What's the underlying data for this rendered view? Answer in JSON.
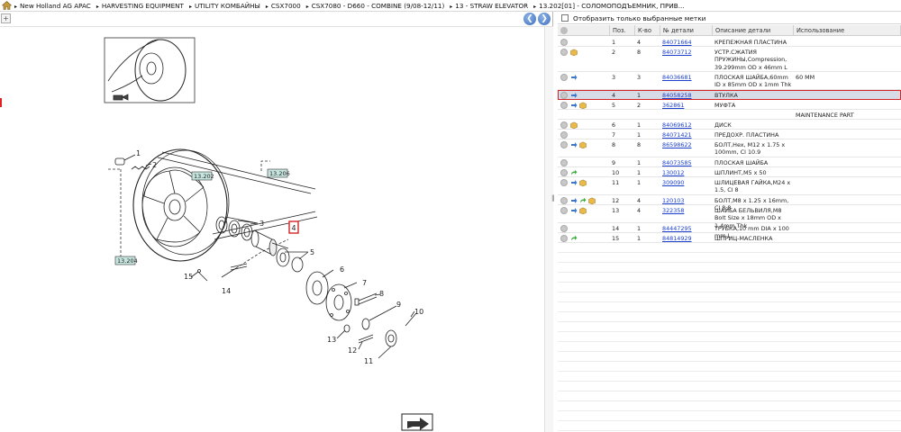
{
  "breadcrumb": [
    "New Holland AG APAC",
    "HARVESTING EQUIPMENT",
    "UTILITY КОМБАЙНЫ",
    "CSX7000",
    "CSX7080 - D660 - COMBINE (9/08-12/11)",
    "13 - STRAW ELEVATOR",
    "13.202[01] - СОЛОМОПОДЪЕМНИК, ПРИВ..."
  ],
  "icons": {
    "home": "home-icon",
    "back": "back-arrow-icon",
    "forward": "forward-arrow-icon",
    "expand": "expand-icon",
    "settings": "settings-icon"
  },
  "nav": {
    "back": "❮",
    "forward": "❯",
    "expand": "+",
    "splitter": "‖"
  },
  "filter": {
    "label": "Отобразить только выбранные метки",
    "checked": false
  },
  "columns": [
    "Поз.",
    "К-во",
    "№ детали",
    "Описание детали",
    "Использование"
  ],
  "colors": {
    "selected_row": "#d6dbe6",
    "highlight": "#d42424",
    "link": "#1a3fcc",
    "callout_bg": "#c7e6e0"
  },
  "diagram": {
    "callouts": [
      "1",
      "2",
      "3",
      "4",
      "5",
      "6",
      "7",
      "8",
      "9",
      "10",
      "11",
      "12",
      "13",
      "14",
      "15"
    ],
    "refs": [
      "13.202",
      "13.206",
      "13.204"
    ]
  },
  "rows": [
    {
      "pos": "1",
      "qty": "4",
      "part": "84071664",
      "desc": "КРЕПЕЖНАЯ ПЛАСТИНА",
      "use": "",
      "icons": []
    },
    {
      "pos": "2",
      "qty": "8",
      "part": "84073712",
      "desc": "УСТР.СЖАТИЯ ПРУЖИНЫ,Compression, 39.299mm OD x 46mm L",
      "use": "",
      "icons": [
        "box"
      ]
    },
    {
      "pos": "3",
      "qty": "3",
      "part": "84036681",
      "desc": "ПЛОСКАЯ ШАЙБА,60mm ID x 85mm OD x 1mm Thk",
      "use": "60 MM",
      "icons": [
        "swap"
      ]
    },
    {
      "pos": "4",
      "qty": "1",
      "part": "84058258",
      "desc": "ВТУЛКА",
      "use": "",
      "icons": [
        "swap"
      ],
      "selected": true
    },
    {
      "pos": "5",
      "qty": "2",
      "part": "362861",
      "desc": "МУФТА",
      "use": "",
      "icons": [
        "swap",
        "box"
      ]
    },
    {
      "pos": "",
      "qty": "",
      "part": "",
      "desc": "",
      "use": "MAINTENANCE PART",
      "icons": [],
      "note": true
    },
    {
      "pos": "6",
      "qty": "1",
      "part": "84069612",
      "desc": "ДИСК",
      "use": "",
      "icons": [
        "box"
      ]
    },
    {
      "pos": "7",
      "qty": "1",
      "part": "84071421",
      "desc": "ПРЕДОХР. ПЛАСТИНА",
      "use": "",
      "icons": []
    },
    {
      "pos": "8",
      "qty": "8",
      "part": "86598622",
      "desc": "БОЛТ,Hex, M12 x 1.75 x 100mm, Cl 10.9",
      "use": "",
      "icons": [
        "swap",
        "box"
      ]
    },
    {
      "pos": "9",
      "qty": "1",
      "part": "84073585",
      "desc": "ПЛОСКАЯ ШАЙБА",
      "use": "",
      "icons": []
    },
    {
      "pos": "10",
      "qty": "1",
      "part": "130012",
      "desc": "ШПЛИНТ,M5 x 50",
      "use": "",
      "icons": [
        "arrow"
      ]
    },
    {
      "pos": "11",
      "qty": "1",
      "part": "309090",
      "desc": "ШЛИЦЕВАЯ ГАЙКА,M24 x 1.5, Cl 8",
      "use": "",
      "icons": [
        "swap",
        "box"
      ]
    },
    {
      "pos": "12",
      "qty": "4",
      "part": "120103",
      "desc": "БОЛТ,M8 x 1.25 x 16mm, Cl 8.8",
      "use": "",
      "icons": [
        "swap",
        "arrow",
        "box"
      ]
    },
    {
      "pos": "13",
      "qty": "4",
      "part": "322358",
      "desc": "ШАЙБА БЕЛЬВИЛЯ,M8 Bolt Size x 18mm OD x 1.4mm Thk",
      "use": "",
      "icons": [
        "swap",
        "box"
      ]
    },
    {
      "pos": "14",
      "qty": "1",
      "part": "84447295",
      "desc": "ТРУБКА,10 mm DIA x 100 mm L",
      "use": "",
      "icons": []
    },
    {
      "pos": "15",
      "qty": "1",
      "part": "84814929",
      "desc": "ШПРИЦ-МАСЛЕНКА",
      "use": "",
      "icons": [
        "arrow"
      ]
    }
  ]
}
